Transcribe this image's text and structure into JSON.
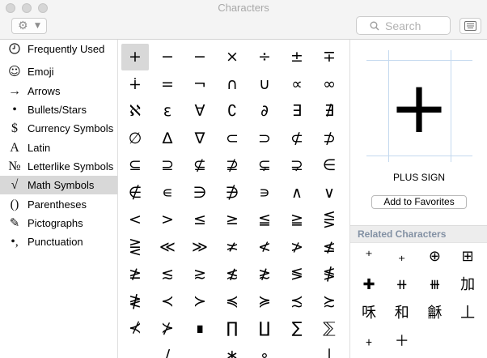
{
  "window": {
    "title": "Characters"
  },
  "toolbar": {
    "action_icon": "gear-icon",
    "search_placeholder": "Search",
    "viewer_icon": "keyboard-viewer-icon"
  },
  "sidebar": {
    "items": [
      {
        "label": "Frequently Used",
        "icon": "clock-icon"
      },
      {
        "label": "Emoji",
        "icon": "smiley-icon",
        "glyph": "☺"
      },
      {
        "label": "Arrows",
        "icon": "arrow-icon",
        "glyph": "→"
      },
      {
        "label": "Bullets/Stars",
        "icon": "bullet-icon",
        "glyph": "•"
      },
      {
        "label": "Currency Symbols",
        "icon": "dollar-icon",
        "glyph": "$"
      },
      {
        "label": "Latin",
        "icon": "latin-letter-icon",
        "glyph": "A"
      },
      {
        "label": "Letterlike Symbols",
        "icon": "numero-icon",
        "glyph": "№"
      },
      {
        "label": "Math Symbols",
        "icon": "square-root-icon",
        "glyph": "√",
        "selected": true
      },
      {
        "label": "Parentheses",
        "icon": "parentheses-icon",
        "glyph": "()"
      },
      {
        "label": "Pictographs",
        "icon": "pencil-icon",
        "glyph": "✎"
      },
      {
        "label": "Punctuation",
        "icon": "punctuation-icon",
        "glyph": "•,"
      }
    ]
  },
  "grid": {
    "selected": "+",
    "rows": [
      [
        "+",
        "−",
        "−",
        "×",
        "÷",
        "±",
        "∓"
      ],
      [
        "∔",
        "=",
        "¬",
        "∩",
        "∪",
        "∝",
        "∞"
      ],
      [
        "ℵ",
        "ε",
        "∀",
        "∁",
        "∂",
        "∃",
        "∄"
      ],
      [
        "∅",
        "∆",
        "∇",
        "⊂",
        "⊃",
        "⊄",
        "⊅"
      ],
      [
        "⊆",
        "⊇",
        "⊈",
        "⊉",
        "⊊",
        "⊋",
        "∈"
      ],
      [
        "∉",
        "∊",
        "∋",
        "∌",
        "∍",
        "∧",
        "∨"
      ],
      [
        "<",
        ">",
        "≤",
        "≥",
        "≦",
        "≧",
        "⋚"
      ],
      [
        "⋛",
        "≪",
        "≫",
        "≭",
        "≮",
        "≯",
        "≰"
      ],
      [
        "≱",
        "≲",
        "≳",
        "≴",
        "≵",
        "≶",
        "≸"
      ],
      [
        "≹",
        "≺",
        "≻",
        "≼",
        "≽",
        "≾",
        "≿"
      ],
      [
        "⊀",
        "⊁",
        "∎",
        "∏",
        "∐",
        "∑",
        "⅀"
      ],
      [
        "",
        "∕",
        "",
        "∗",
        "∘",
        "",
        "∣"
      ]
    ]
  },
  "detail": {
    "character": "+",
    "name": "PLUS SIGN",
    "favorites_button": "Add to Favorites"
  },
  "related": {
    "title": "Related Characters",
    "rows": [
      [
        "⁺",
        "₊",
        "⊕",
        "⊞"
      ],
      [
        "✚",
        "⧺",
        "⧻",
        "加"
      ],
      [
        "咊",
        "和",
        "龢",
        "丄"
      ],
      [
        "﹢",
        "＋"
      ]
    ]
  },
  "colors": {
    "selection_background": "#d8d8d8",
    "guide_line": "#c4d9ef",
    "related_header_text": "#8391a4"
  }
}
